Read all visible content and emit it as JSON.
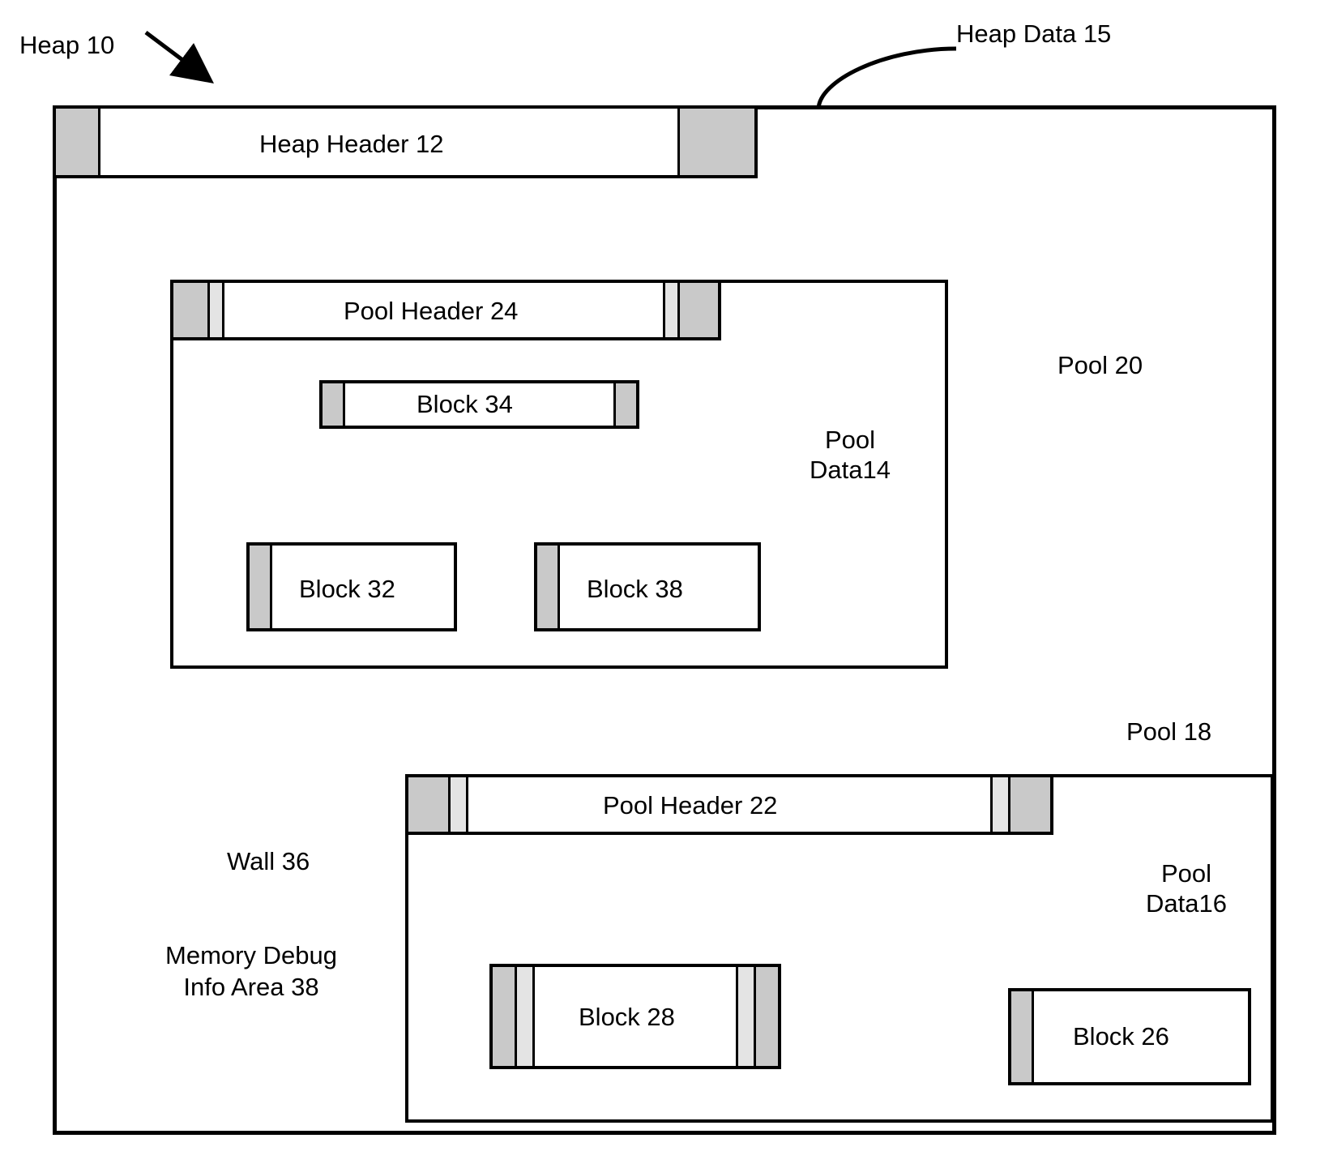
{
  "labels": {
    "heap_main": "Heap 10",
    "heap_data": "Heap Data 15",
    "pool20": "Pool  20",
    "pool18": "Pool  18",
    "pool_data14": "Pool Data14",
    "pool_data16": "Pool Data16",
    "wall36": "Wall  36",
    "memdebug": "Memory Debug Info Area  38"
  },
  "headers": {
    "heap_header": "Heap Header  12",
    "pool_header24": "Pool Header  24",
    "pool_header22": "Pool Header  22"
  },
  "blocks": {
    "block34": "Block  34",
    "block32": "Block 32",
    "block38": "Block  38",
    "block28": "Block  28",
    "block26": "Block  26"
  }
}
